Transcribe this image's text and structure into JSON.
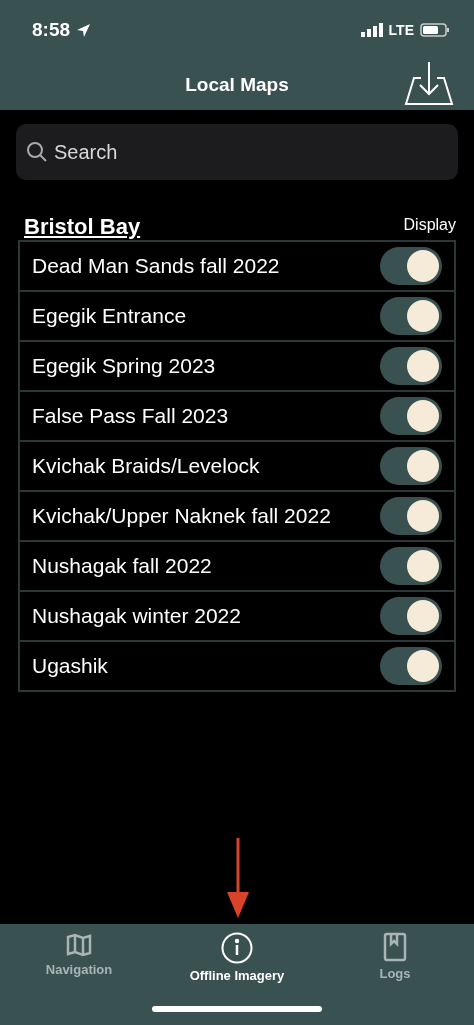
{
  "status_bar": {
    "time": "8:58",
    "network": "LTE"
  },
  "nav_bar": {
    "title": "Local Maps"
  },
  "search": {
    "placeholder": "Search"
  },
  "section": {
    "title": "Bristol Bay",
    "column_label": "Display",
    "items": [
      {
        "label": "Dead Man Sands fall 2022",
        "on": true
      },
      {
        "label": "Egegik Entrance",
        "on": true
      },
      {
        "label": "Egegik Spring 2023",
        "on": true
      },
      {
        "label": "False Pass Fall 2023",
        "on": true
      },
      {
        "label": "Kvichak Braids/Levelock",
        "on": true
      },
      {
        "label": "Kvichak/Upper Naknek fall 2022",
        "on": true
      },
      {
        "label": "Nushagak fall 2022",
        "on": true
      },
      {
        "label": "Nushagak winter 2022",
        "on": true
      },
      {
        "label": "Ugashik",
        "on": true
      }
    ]
  },
  "tab_bar": [
    {
      "label": "Navigation",
      "kind": "map",
      "selected": false
    },
    {
      "label": "Offline Imagery",
      "kind": "info",
      "selected": true
    },
    {
      "label": "Logs",
      "kind": "book",
      "selected": false
    }
  ]
}
